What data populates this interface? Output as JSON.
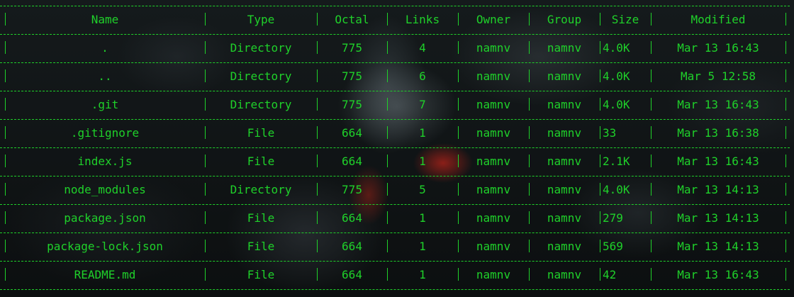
{
  "table": {
    "columns": [
      "Name",
      "Type",
      "Octal",
      "Links",
      "Owner",
      "Group",
      "Size",
      "Modified"
    ],
    "rows": [
      [
        ".",
        "Directory",
        "775",
        "4",
        "namnv",
        "namnv",
        "4.0K",
        "Mar 13 16:43"
      ],
      [
        "..",
        "Directory",
        "775",
        "6",
        "namnv",
        "namnv",
        "4.0K",
        "Mar 5 12:58"
      ],
      [
        ".git",
        "Directory",
        "775",
        "7",
        "namnv",
        "namnv",
        "4.0K",
        "Mar 13 16:43"
      ],
      [
        ".gitignore",
        "File",
        "664",
        "1",
        "namnv",
        "namnv",
        "33",
        "Mar 13 16:38"
      ],
      [
        "index.js",
        "File",
        "664",
        "1",
        "namnv",
        "namnv",
        "2.1K",
        "Mar 13 16:43"
      ],
      [
        "node_modules",
        "Directory",
        "775",
        "5",
        "namnv",
        "namnv",
        "4.0K",
        "Mar 13 14:13"
      ],
      [
        "package.json",
        "File",
        "664",
        "1",
        "namnv",
        "namnv",
        "279",
        "Mar 13 14:13"
      ],
      [
        "package-lock.json",
        "File",
        "664",
        "1",
        "namnv",
        "namnv",
        "569",
        "Mar 13 14:13"
      ],
      [
        "README.md",
        "File",
        "664",
        "1",
        "namnv",
        "namnv",
        "42",
        "Mar 13 16:43"
      ]
    ]
  },
  "colors": {
    "text": "#1fd12a",
    "background": "#0d1011"
  }
}
